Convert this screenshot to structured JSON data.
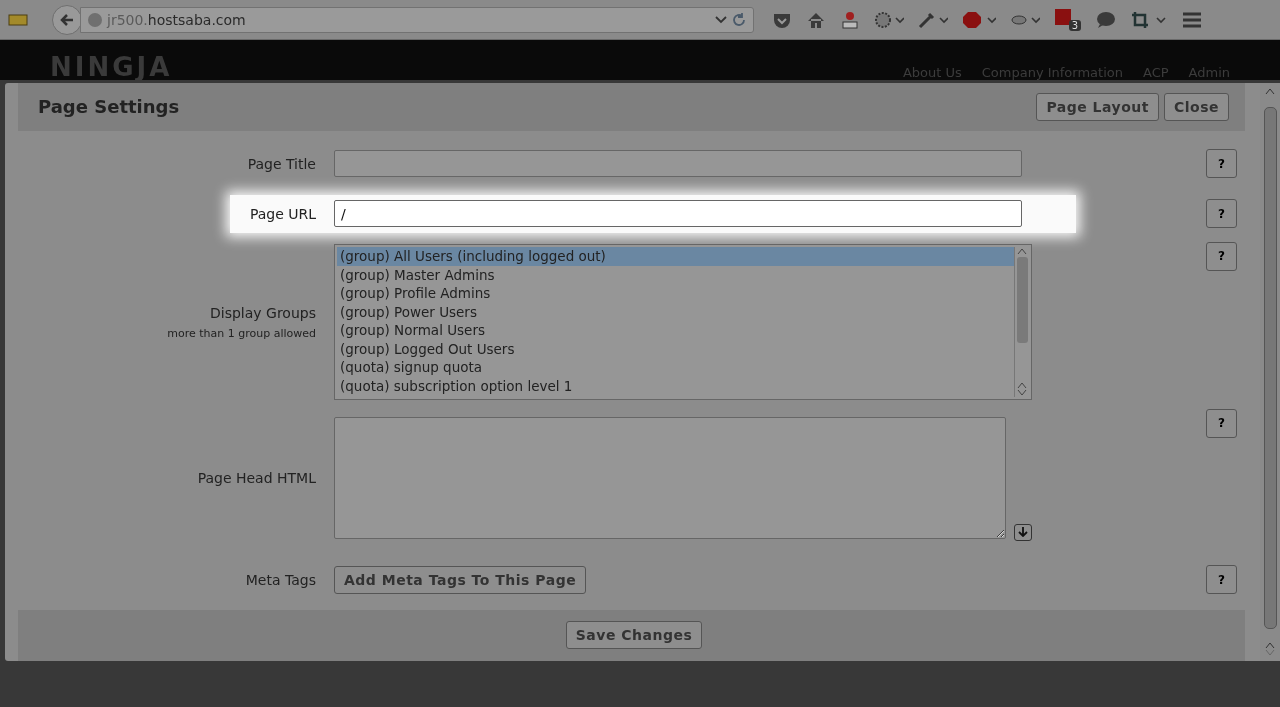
{
  "browser": {
    "url_subdomain": "jr500.",
    "url_domain": "hostsaba.com",
    "badge_count": "3"
  },
  "site": {
    "logo": "NINGJA",
    "nav": [
      "About Us",
      "Company Information",
      "ACP",
      "Admin"
    ]
  },
  "modal": {
    "title": "Page Settings",
    "header_buttons": [
      "Page Layout",
      "Close"
    ],
    "rows": [
      {
        "kind": "text",
        "label": "Page Title",
        "value": "",
        "highlighted": false,
        "help": "?"
      },
      {
        "kind": "text",
        "label": "Page URL",
        "value": "/",
        "highlighted": true,
        "help": "?"
      },
      {
        "kind": "list",
        "label": "Display Groups",
        "note": "more than 1 group allowed",
        "help": "?",
        "options": [
          {
            "text": "(group) All Users (including logged out)",
            "selected": true
          },
          {
            "text": "(group) Master Admins",
            "selected": false
          },
          {
            "text": "(group) Profile Admins",
            "selected": false
          },
          {
            "text": "(group) Power Users",
            "selected": false
          },
          {
            "text": "(group) Normal Users",
            "selected": false
          },
          {
            "text": "(group) Logged Out Users",
            "selected": false
          },
          {
            "text": "(quota) signup quota",
            "selected": false
          },
          {
            "text": "(quota) subscription option level 1",
            "selected": false
          }
        ]
      },
      {
        "kind": "textarea",
        "label": "Page Head HTML",
        "value": "",
        "help": "?"
      },
      {
        "kind": "button",
        "label": "Meta Tags",
        "button": "Add Meta Tags To This Page",
        "help": "?"
      }
    ],
    "save": "Save Changes"
  }
}
